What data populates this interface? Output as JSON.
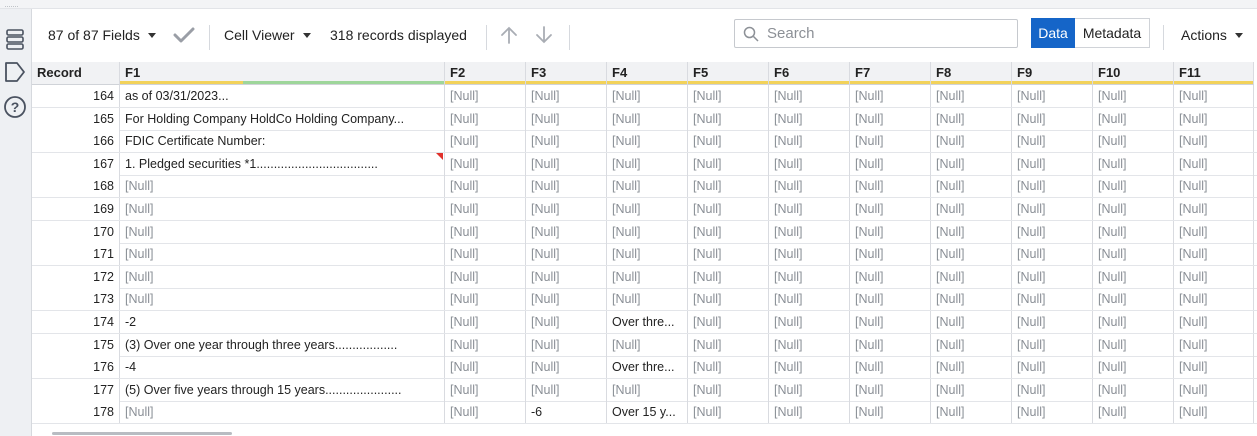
{
  "toolbar": {
    "fields_label": "87 of 87 Fields",
    "cell_viewer_label": "Cell Viewer",
    "records_label": "318 records displayed",
    "search_placeholder": "Search",
    "data_label": "Data",
    "metadata_label": "Metadata",
    "actions_label": "Actions",
    "active_view": "Data"
  },
  "colors": {
    "accent": "#1565c8",
    "null_text": "#8a8f96",
    "header_bar_green": "#9ed69a",
    "header_bar_yellow": "#f2d25a",
    "flag_red": "#e0312b"
  },
  "grid": {
    "record_header": "Record",
    "columns": [
      "F1",
      "F2",
      "F3",
      "F4",
      "F5",
      "F6",
      "F7",
      "F8",
      "F9",
      "F10",
      "F11"
    ],
    "rows": [
      {
        "record": "164",
        "cells": [
          "as of 03/31/2023...",
          "[Null]",
          "[Null]",
          "[Null]",
          "[Null]",
          "[Null]",
          "[Null]",
          "[Null]",
          "[Null]",
          "[Null]",
          "[Null]"
        ]
      },
      {
        "record": "165",
        "cells": [
          "For Holding Company HoldCo Holding Company...",
          "[Null]",
          "[Null]",
          "[Null]",
          "[Null]",
          "[Null]",
          "[Null]",
          "[Null]",
          "[Null]",
          "[Null]",
          "[Null]"
        ]
      },
      {
        "record": "166",
        "cells": [
          "FDIC Certificate Number:",
          "[Null]",
          "[Null]",
          "[Null]",
          "[Null]",
          "[Null]",
          "[Null]",
          "[Null]",
          "[Null]",
          "[Null]",
          "[Null]"
        ]
      },
      {
        "record": "167",
        "cells": [
          "1.          Pledged  securities *1...................................",
          "[Null]",
          "[Null]",
          "[Null]",
          "[Null]",
          "[Null]",
          "[Null]",
          "[Null]",
          "[Null]",
          "[Null]",
          "[Null]"
        ],
        "flag": true
      },
      {
        "record": "168",
        "cells": [
          "[Null]",
          "[Null]",
          "[Null]",
          "[Null]",
          "[Null]",
          "[Null]",
          "[Null]",
          "[Null]",
          "[Null]",
          "[Null]",
          "[Null]"
        ]
      },
      {
        "record": "169",
        "cells": [
          "[Null]",
          "[Null]",
          "[Null]",
          "[Null]",
          "[Null]",
          "[Null]",
          "[Null]",
          "[Null]",
          "[Null]",
          "[Null]",
          "[Null]"
        ]
      },
      {
        "record": "170",
        "cells": [
          "[Null]",
          "[Null]",
          "[Null]",
          "[Null]",
          "[Null]",
          "[Null]",
          "[Null]",
          "[Null]",
          "[Null]",
          "[Null]",
          "[Null]"
        ]
      },
      {
        "record": "171",
        "cells": [
          "[Null]",
          "[Null]",
          "[Null]",
          "[Null]",
          "[Null]",
          "[Null]",
          "[Null]",
          "[Null]",
          "[Null]",
          "[Null]",
          "[Null]"
        ]
      },
      {
        "record": "172",
        "cells": [
          "[Null]",
          "[Null]",
          "[Null]",
          "[Null]",
          "[Null]",
          "[Null]",
          "[Null]",
          "[Null]",
          "[Null]",
          "[Null]",
          "[Null]"
        ]
      },
      {
        "record": "173",
        "cells": [
          "[Null]",
          "[Null]",
          "[Null]",
          "[Null]",
          "[Null]",
          "[Null]",
          "[Null]",
          "[Null]",
          "[Null]",
          "[Null]",
          "[Null]"
        ]
      },
      {
        "record": "174",
        "cells": [
          "-2",
          "[Null]",
          "[Null]",
          "Over thre...",
          "[Null]",
          "[Null]",
          "[Null]",
          "[Null]",
          "[Null]",
          "[Null]",
          "[Null]"
        ]
      },
      {
        "record": "175",
        "cells": [
          "(3)          Over one year through three years..................",
          "[Null]",
          "[Null]",
          "[Null]",
          "[Null]",
          "[Null]",
          "[Null]",
          "[Null]",
          "[Null]",
          "[Null]",
          "[Null]"
        ]
      },
      {
        "record": "176",
        "cells": [
          "-4",
          "[Null]",
          "[Null]",
          "Over thre...",
          "[Null]",
          "[Null]",
          "[Null]",
          "[Null]",
          "[Null]",
          "[Null]",
          "[Null]"
        ]
      },
      {
        "record": "177",
        "cells": [
          "(5)          Over five years through  15 years......................",
          "[Null]",
          "[Null]",
          "[Null]",
          "[Null]",
          "[Null]",
          "[Null]",
          "[Null]",
          "[Null]",
          "[Null]",
          "[Null]"
        ]
      },
      {
        "record": "178",
        "cells": [
          "[Null]",
          "[Null]",
          "-6",
          "Over 15 y...",
          "[Null]",
          "[Null]",
          "[Null]",
          "[Null]",
          "[Null]",
          "[Null]",
          "[Null]"
        ]
      }
    ]
  }
}
